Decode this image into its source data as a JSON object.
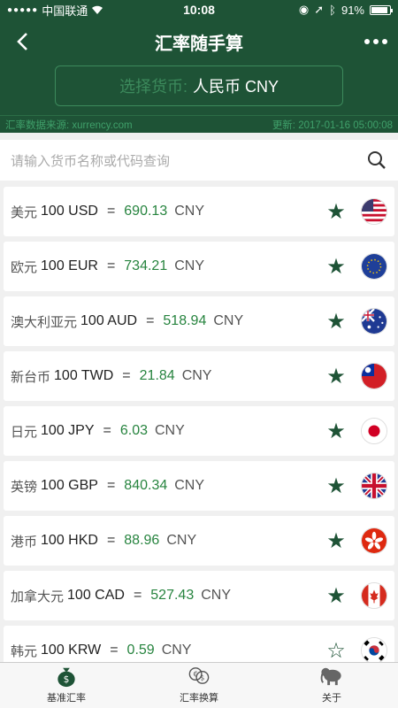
{
  "status_bar": {
    "carrier": "中国联通",
    "time": "10:08",
    "battery": "91%",
    "battery_level": 0.91
  },
  "nav": {
    "title": "汇率随手算"
  },
  "currency_select": {
    "label": "选择货币:",
    "value": "人民币 CNY"
  },
  "info": {
    "source": "汇率数据来源: xurrency.com",
    "updated": "更新: 2017-01-16 05:00:08"
  },
  "search": {
    "placeholder": "请输入货币名称或代码查询"
  },
  "rates": [
    {
      "name": "美元",
      "amount": "100 USD",
      "eq": "=",
      "rate": "690.13",
      "unit": "CNY",
      "starred": true,
      "flag": "us-flag-icon"
    },
    {
      "name": "欧元",
      "amount": "100 EUR",
      "eq": "=",
      "rate": "734.21",
      "unit": "CNY",
      "starred": true,
      "flag": "eu-flag-icon"
    },
    {
      "name": "澳大利亚元",
      "amount": "100 AUD",
      "eq": "=",
      "rate": "518.94",
      "unit": "CNY",
      "starred": true,
      "flag": "au-flag-icon"
    },
    {
      "name": "新台币",
      "amount": "100 TWD",
      "eq": "=",
      "rate": "21.84",
      "unit": "CNY",
      "starred": true,
      "flag": "tw-flag-icon"
    },
    {
      "name": "日元",
      "amount": "100 JPY",
      "eq": "=",
      "rate": "6.03",
      "unit": "CNY",
      "starred": true,
      "flag": "jp-flag-icon"
    },
    {
      "name": "英镑",
      "amount": "100 GBP",
      "eq": "=",
      "rate": "840.34",
      "unit": "CNY",
      "starred": true,
      "flag": "gb-flag-icon"
    },
    {
      "name": "港币",
      "amount": "100 HKD",
      "eq": "=",
      "rate": "88.96",
      "unit": "CNY",
      "starred": true,
      "flag": "hk-flag-icon"
    },
    {
      "name": "加拿大元",
      "amount": "100 CAD",
      "eq": "=",
      "rate": "527.43",
      "unit": "CNY",
      "starred": true,
      "flag": "ca-flag-icon"
    },
    {
      "name": "韩元",
      "amount": "100 KRW",
      "eq": "=",
      "rate": "0.59",
      "unit": "CNY",
      "starred": false,
      "flag": "kr-flag-icon"
    }
  ],
  "tabs": [
    {
      "label": "基准汇率",
      "icon": "money-bag-icon"
    },
    {
      "label": "汇率换算",
      "icon": "exchange-icon"
    },
    {
      "label": "关于",
      "icon": "elephant-icon"
    }
  ],
  "colors": {
    "primary": "#1e5336",
    "rate": "#27843f",
    "accent": "#3c8a5c"
  }
}
